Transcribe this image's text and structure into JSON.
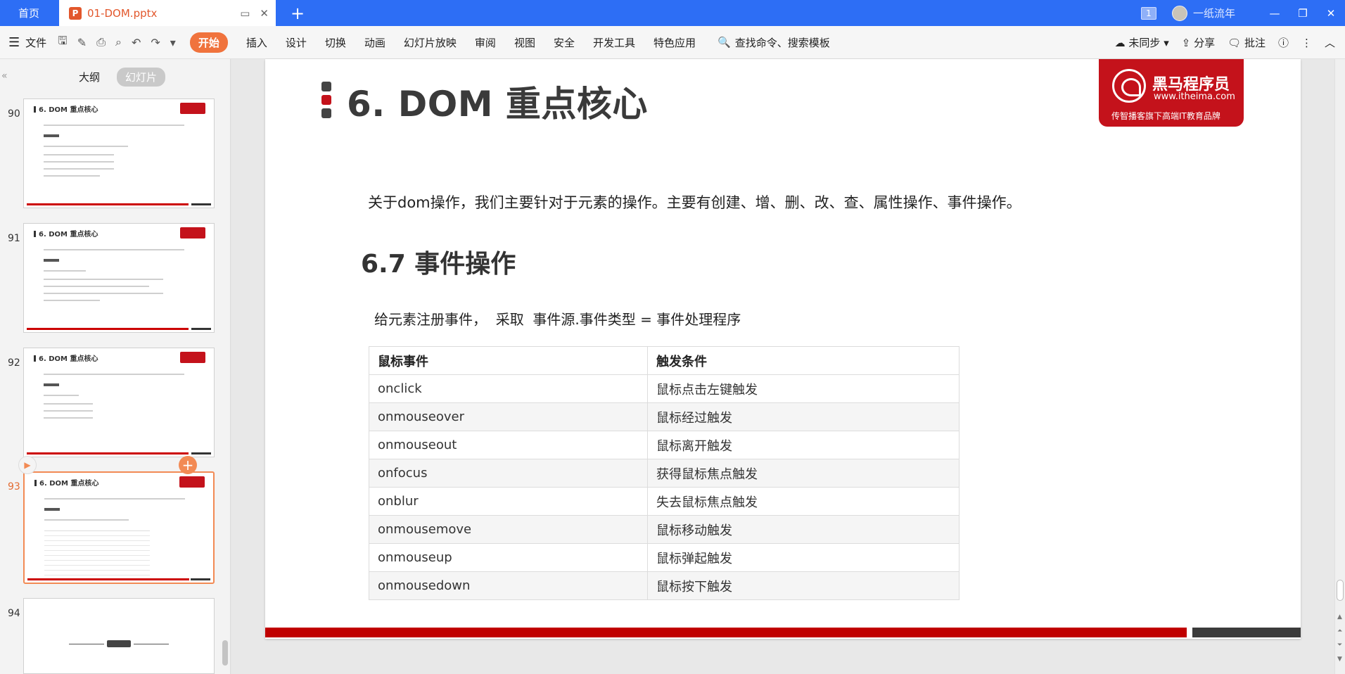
{
  "titlebar": {
    "home_tab": "首页",
    "doc_tab": "01-DOM.pptx",
    "doc_icon": "P",
    "add_tab": "+",
    "page_count": "1",
    "user_name": "一纸流年"
  },
  "ribbon": {
    "file_menu": "文件",
    "tabs": [
      "开始",
      "插入",
      "设计",
      "切换",
      "动画",
      "幻灯片放映",
      "审阅",
      "视图",
      "安全",
      "开发工具",
      "特色应用"
    ],
    "search_label": "查找命令、搜索模板",
    "sync_label": "未同步",
    "share_label": "分享",
    "comment_label": "批注"
  },
  "left_panel": {
    "tab_outline": "大纲",
    "tab_slides": "幻灯片",
    "thumbs": [
      {
        "num": "90",
        "title": "6. DOM 重点核心"
      },
      {
        "num": "91",
        "title": "6. DOM 重点核心"
      },
      {
        "num": "92",
        "title": "6. DOM 重点核心"
      },
      {
        "num": "93",
        "title": "6. DOM 重点核心"
      },
      {
        "num": "94",
        "title": ""
      }
    ]
  },
  "slide": {
    "title": "6. DOM 重点核心",
    "brand_name": "黑马程序员",
    "brand_url": "www.itheima.com",
    "brand_slogan": "传智播客旗下高端IT教育品牌",
    "intro": "关于dom操作，我们主要针对于元素的操作。主要有创建、增、删、改、查、属性操作、事件操作。",
    "section_title": "6.7 事件操作",
    "formula": "给元素注册事件，  采取  事件源.事件类型 = 事件处理程序",
    "table_headers": [
      "鼠标事件",
      "触发条件"
    ],
    "table_rows": [
      [
        "onclick",
        "鼠标点击左键触发"
      ],
      [
        "onmouseover",
        "鼠标经过触发"
      ],
      [
        "onmouseout",
        "鼠标离开触发"
      ],
      [
        "onfocus",
        "获得鼠标焦点触发"
      ],
      [
        "onblur",
        "失去鼠标焦点触发"
      ],
      [
        "onmousemove",
        "鼠标移动触发"
      ],
      [
        "onmouseup",
        "鼠标弹起触发"
      ],
      [
        "onmousedown",
        "鼠标按下触发"
      ]
    ]
  },
  "colors": {
    "titlebar": "#2d6ef5",
    "accent_orange": "#f0733d",
    "brand_red": "#c4121b",
    "footer_red": "#c00000"
  }
}
